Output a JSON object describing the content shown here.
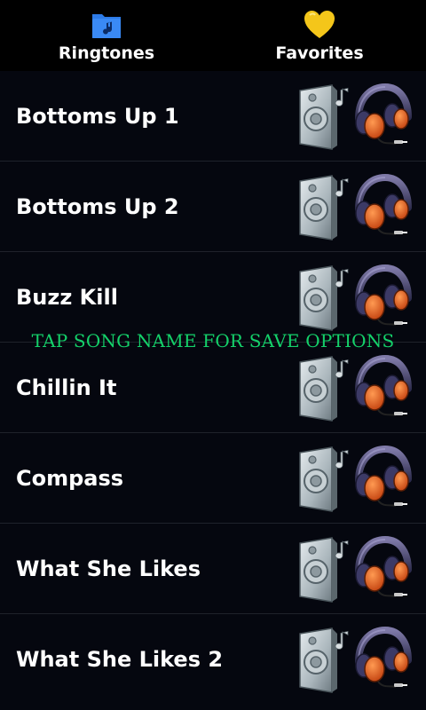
{
  "tabs": [
    {
      "label": "Ringtones",
      "icon": "folder-music-icon",
      "color": "#2d7be8"
    },
    {
      "label": "Favorites",
      "icon": "heart-icon",
      "color": "#f4c61a"
    }
  ],
  "songs": [
    {
      "name": "Bottoms Up 1"
    },
    {
      "name": "Bottoms Up 2"
    },
    {
      "name": "Buzz Kill"
    },
    {
      "name": "Chillin It"
    },
    {
      "name": "Compass"
    },
    {
      "name": "What She Likes"
    },
    {
      "name": "What She Likes 2"
    }
  ],
  "overlay_text": "TAP SONG NAME FOR SAVE OPTIONS",
  "row_icons": [
    "speaker-note-icon",
    "headphones-icon"
  ],
  "colors": {
    "background": "#05070f",
    "overlay_text": "#14d16a",
    "divider": "#1f222b"
  }
}
